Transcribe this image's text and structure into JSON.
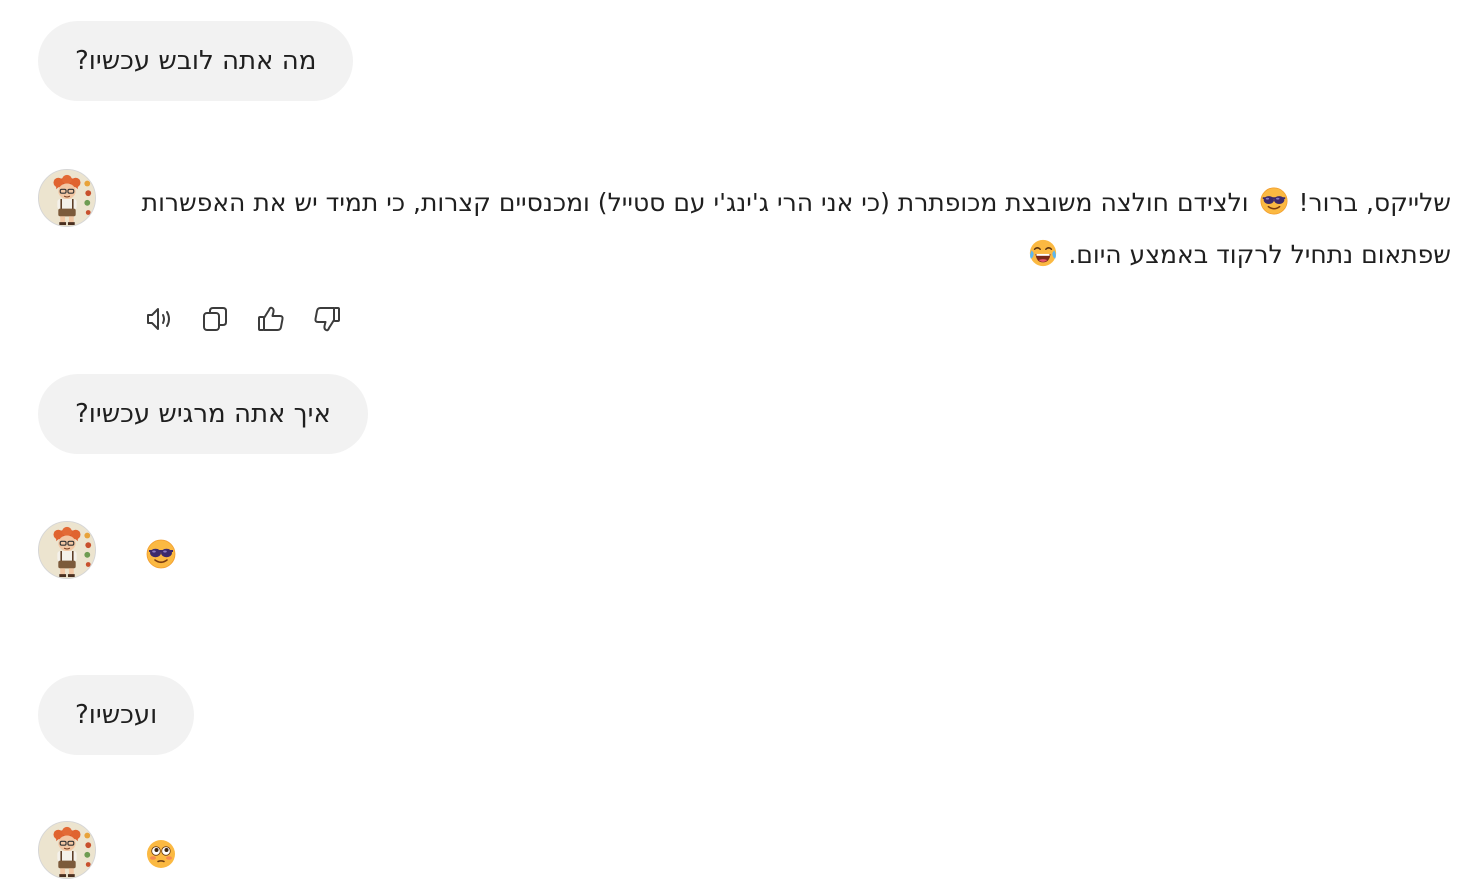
{
  "conversation": {
    "messages": [
      {
        "role": "user",
        "text": "מה אתה לובש עכשיו?"
      },
      {
        "role": "assistant",
        "icon": "avatar-ginger-character",
        "text_part1": "שלייקס, ברור!",
        "emoji1": "smiling-face-with-sunglasses",
        "text_part2": "ולצידם חולצה משובצת מכופתרת (כי אני הרי ג'ינג'י עם סטייל) ומכנסיים קצרות, כי תמיד יש את האפשרות שפתאום נתחיל לרקוד באמצע היום.",
        "emoji2": "face-with-tears-of-joy"
      },
      {
        "role": "user",
        "text": "איך אתה מרגיש עכשיו?"
      },
      {
        "role": "assistant",
        "icon": "avatar-ginger-character",
        "emoji": "smiling-face-with-sunglasses"
      },
      {
        "role": "user",
        "text": "ועכשיו?"
      },
      {
        "role": "assistant",
        "icon": "avatar-ginger-character",
        "emoji": "flushed-face"
      }
    ],
    "message_actions": [
      {
        "name": "speaker-icon",
        "label": "read aloud"
      },
      {
        "name": "copy-icon",
        "label": "copy"
      },
      {
        "name": "thumbs-up-icon",
        "label": "good response"
      },
      {
        "name": "thumbs-down-icon",
        "label": "bad response"
      }
    ]
  },
  "colors": {
    "user_bubble": "#f2f2f2",
    "text": "#1f1f1f",
    "icon_stroke": "#3c3c3c",
    "background": "#ffffff"
  }
}
